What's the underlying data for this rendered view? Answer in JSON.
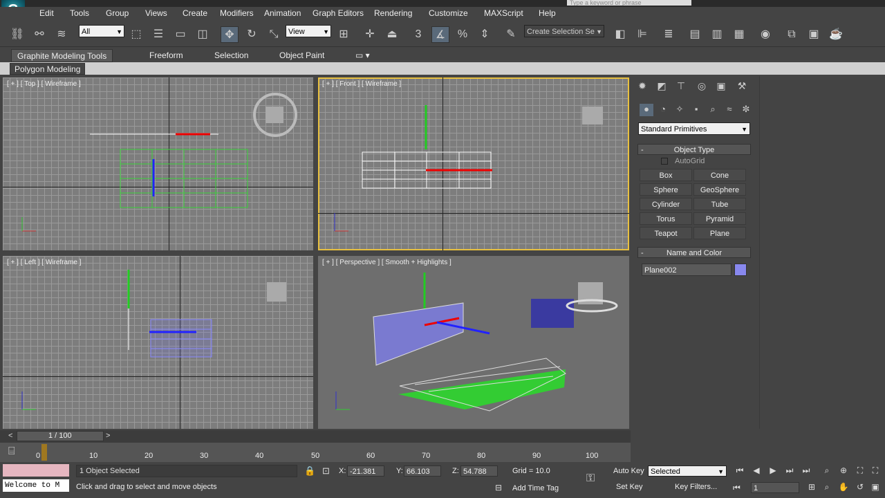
{
  "title_bar": {
    "logo": "G",
    "search_placeholder": "Type a keyword or phrase"
  },
  "menu": [
    "Edit",
    "Tools",
    "Group",
    "Views",
    "Create",
    "Modifiers",
    "Animation",
    "Graph Editors",
    "Rendering",
    "Customize",
    "MAXScript",
    "Help"
  ],
  "toolbar": {
    "selection_filter": "All",
    "reference_coord": "View",
    "snap_label": "3",
    "named_selection_placeholder": "Create Selection Se"
  },
  "ribbon": {
    "tabs": [
      "Graphite Modeling Tools",
      "Freeform",
      "Selection",
      "Object Paint"
    ],
    "panel": "Polygon Modeling"
  },
  "viewports": {
    "top": "[ + ] [ Top ] [ Wireframe ]",
    "front": "[ + ] [ Front ] [ Wireframe ]",
    "left": "[ + ] [ Left ] [ Wireframe ]",
    "perspective": "[ + ] [ Perspective ] [ Smooth + Highlights ]"
  },
  "command_panel": {
    "category": "Standard Primitives",
    "object_type_title": "Object Type",
    "autogrid": "AutoGrid",
    "buttons": [
      "Box",
      "Cone",
      "Sphere",
      "GeoSphere",
      "Cylinder",
      "Tube",
      "Torus",
      "Pyramid",
      "Teapot",
      "Plane"
    ],
    "name_color_title": "Name and Color",
    "object_name": "Plane002",
    "object_color": "#8888ee",
    "minus": "-"
  },
  "timeline": {
    "frame": "1 / 100",
    "ticks": [
      "0",
      "10",
      "20",
      "30",
      "40",
      "50",
      "60",
      "70",
      "80",
      "90",
      "100"
    ]
  },
  "status": {
    "listener_text": "Welcome to M",
    "selection": "1 Object Selected",
    "prompt": "Click and drag to select and move objects",
    "x_label": "X:",
    "x": "-21.381",
    "y_label": "Y:",
    "y": "66.103",
    "z_label": "Z:",
    "z": "54.788",
    "grid": "Grid = 10.0",
    "add_time_tag": "Add Time Tag",
    "auto_key": "Auto Key",
    "set_key": "Set Key",
    "key_mode": "Selected",
    "key_filters": "Key Filters...",
    "current_frame": "1"
  }
}
